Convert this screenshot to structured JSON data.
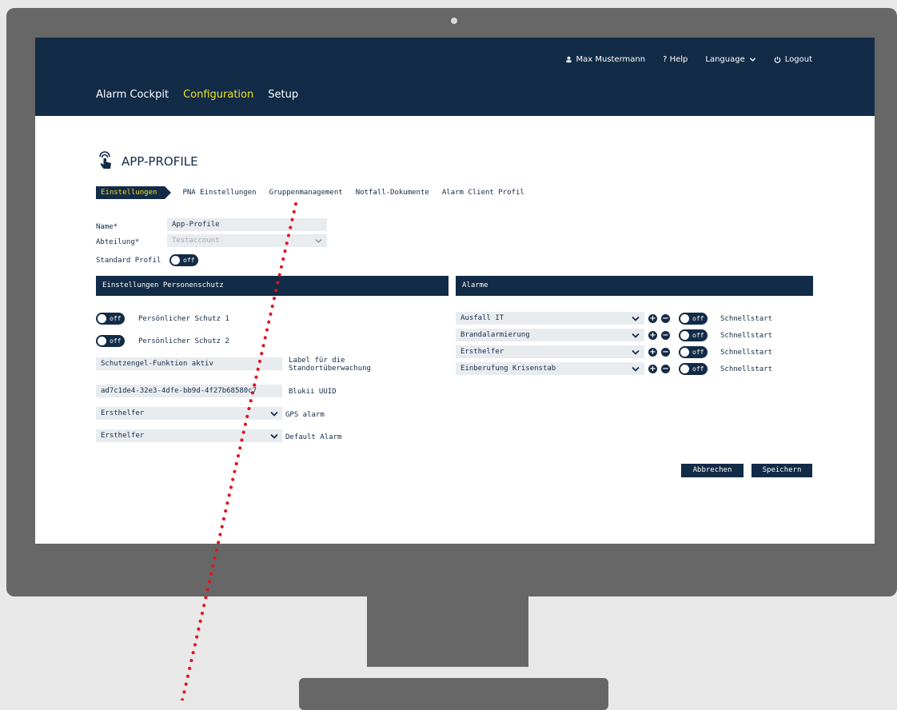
{
  "header": {
    "user": "Max Mustermann",
    "help": "? Help",
    "language": "Language",
    "logout": "Logout",
    "nav": [
      "Alarm Cockpit",
      "Configuration",
      "Setup"
    ]
  },
  "page": {
    "title": "APP-PROFILE",
    "subtabs": [
      "Einstellungen",
      "PNA Einstellungen",
      "Gruppenmanagement",
      "Notfall-Dokumente",
      "Alarm Client Profil"
    ]
  },
  "form": {
    "name_label": "Name*",
    "name_value": "App-Profile",
    "abteilung_label": "Abteilung*",
    "abteilung_value": "Testaccount",
    "standard_label": "Standard Profil",
    "toggle_off": "off"
  },
  "personenschutz": {
    "title": "Einstellungen Personenschutz",
    "schutz1": "Persönlicher Schutz 1",
    "schutz2": "Persönlicher Schutz 2",
    "schutzengel_value": "Schutzengel-Funktion aktiv",
    "label_line1": "Label für die",
    "label_line2": "Standortüberwachung",
    "uuid_value": "ad7c1de4-32e3-4dfe-bb9d-4f27b68580c7",
    "uuid_label": "Blukii UUID",
    "gps_value": "Ersthelfer",
    "gps_label": "GPS alarm",
    "default_value": "Ersthelfer",
    "default_label": "Default Alarm"
  },
  "alarme": {
    "title": "Alarme",
    "items": [
      "Ausfall IT",
      "Brandalarmierung",
      "Ersthelfer",
      "Einberufung Krisenstab"
    ],
    "schnellstart": "Schnellstart"
  },
  "buttons": {
    "cancel": "Abbrechen",
    "save": "Speichern"
  },
  "colors": {
    "navy": "#122b47",
    "accent_yellow": "#f0e020",
    "annotation_red": "#e0141c"
  }
}
